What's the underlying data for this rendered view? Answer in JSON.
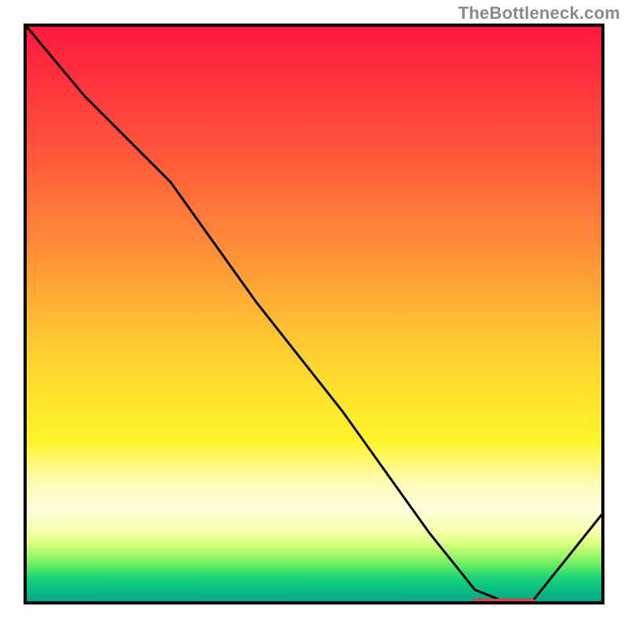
{
  "watermark": "TheBottleneck.com",
  "chart_data": {
    "type": "line",
    "title": "",
    "xlabel": "",
    "ylabel": "",
    "xlim": [
      0,
      100
    ],
    "ylim": [
      0,
      100
    ],
    "grid": false,
    "legend": false,
    "series": [
      {
        "name": "curve",
        "color": "#000000",
        "x": [
          0,
          10,
          25,
          40,
          55,
          70,
          78,
          83,
          88,
          100
        ],
        "values": [
          100,
          88,
          73,
          52,
          33,
          12,
          2,
          0,
          0,
          15
        ],
        "note": "Steep descent with a slight inflection near x≈25, global minimum flat segment around x≈80–90, then a short rise to the right edge."
      },
      {
        "name": "min-marker-segment",
        "color": "#d04848",
        "x": [
          78,
          88
        ],
        "values": [
          0,
          0
        ],
        "note": "Short pinkish-red bar drawn along the minimum of the curve."
      }
    ],
    "background_gradient": {
      "direction": "vertical",
      "stops": [
        {
          "pos": 0.0,
          "color": "#ff183f"
        },
        {
          "pos": 0.38,
          "color": "#ff8b38"
        },
        {
          "pos": 0.72,
          "color": "#fff42a"
        },
        {
          "pos": 0.85,
          "color": "#ffffdd"
        },
        {
          "pos": 0.93,
          "color": "#5deb63"
        },
        {
          "pos": 1.0,
          "color": "#06a785"
        }
      ]
    }
  }
}
